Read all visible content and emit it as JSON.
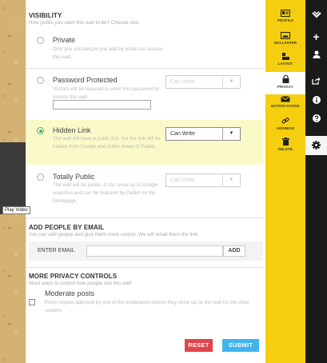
{
  "tooltip": "Play Video",
  "visibility": {
    "title": "VISIBILITY",
    "subtitle": "How public you want this wall to be? Choose one.",
    "options": [
      {
        "title": "Private",
        "description": "Only you and people you add by email can access this wall.",
        "selected": false
      },
      {
        "title": "Password Protected",
        "description": "Visitors will be required to enter this password to access this wall.",
        "permission": "Can View",
        "selected": false
      },
      {
        "title": "Hidden Link",
        "description": "The wall will have a public link, but the link will be hidden from Google and public areas of Padlet.",
        "permission": "Can Write",
        "selected": true
      },
      {
        "title": "Totally Public",
        "description": "The wall will be public. It can show up in Google searches and can be featured by Padlet on the homepage.",
        "permission": "Can View",
        "selected": false
      }
    ]
  },
  "add_people": {
    "title": "ADD PEOPLE BY EMAIL",
    "subtitle": "You can add people and give them more control. We will email them the link.",
    "email_label": "ENTER EMAIL",
    "email_value": "",
    "add_label": "ADD"
  },
  "privacy_controls": {
    "title": "MORE PRIVACY CONTROLS",
    "subtitle": "More ways to control how people use this wall",
    "moderate_title": "Moderate posts",
    "moderate_description": "Posts require approval by one of the moderators before they show up on the wall for the other readers.",
    "moderate_checked": false
  },
  "buttons": {
    "reset": "RESET",
    "submit": "SUBMIT"
  },
  "menu": {
    "items": [
      {
        "label": "PROFILE",
        "icon": "profile-card-icon"
      },
      {
        "label": "WALLPAPER",
        "icon": "wallpaper-icon"
      },
      {
        "label": "LAYOUT",
        "icon": "layout-icon"
      },
      {
        "label": "PRIVACY",
        "icon": "lock-icon",
        "active": true
      },
      {
        "label": "NOTIFICATIONS",
        "icon": "envelope-icon"
      },
      {
        "label": "ADDRESS",
        "icon": "link-icon"
      },
      {
        "label": "DELETE",
        "icon": "trash-icon"
      }
    ]
  },
  "toolbar": {
    "icons": [
      "chevron-icon",
      "plus-icon",
      "user-icon",
      "share-icon",
      "info-icon",
      "help-icon",
      "gear-icon"
    ]
  },
  "colors": {
    "menu_bg": "#f5cf0f",
    "toolbar_bg": "#1a1a1a",
    "selected_bg": "#fafac8",
    "radio_on": "#4caf50",
    "reset": "#e0444d",
    "submit": "#3fb4ee"
  }
}
